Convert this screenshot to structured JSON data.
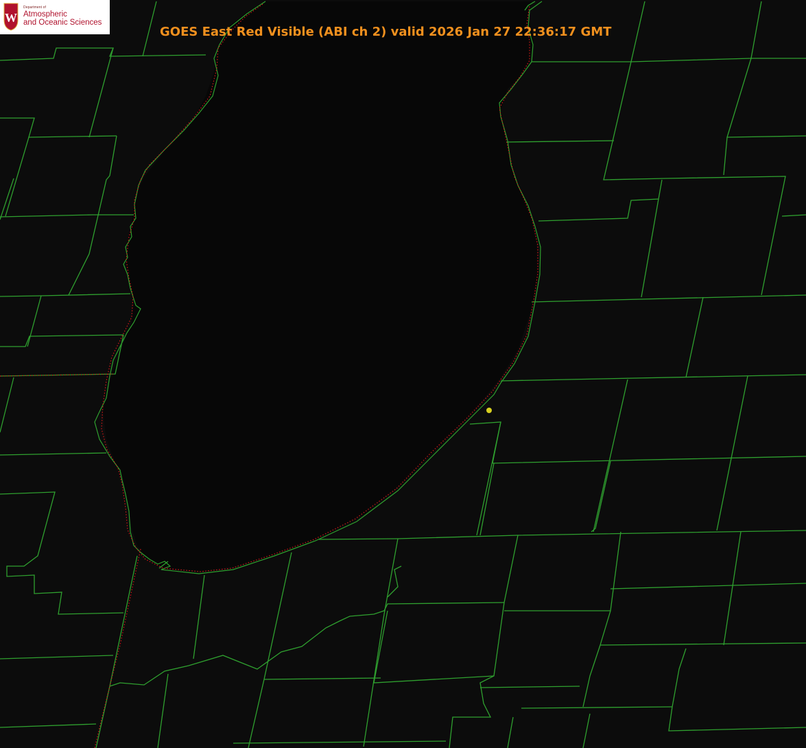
{
  "header": {
    "title": "GOES East Red Visible (ABI ch 2) valid 2026 Jan 27 22:36:17 GMT"
  },
  "logo": {
    "department": "Department of",
    "line1": "Atmospheric",
    "line2": "and Oceanic Sciences"
  },
  "colors": {
    "background": "#0c0c0c",
    "lake": "#070707",
    "county_lines": "#2fa02f",
    "coastline_dotted": "#d01818",
    "marker": "#d8d020",
    "title": "#f0901e",
    "logo_red": "#b0122d"
  },
  "map": {
    "feature": "lake-water-body",
    "marker": "yellow-point"
  }
}
